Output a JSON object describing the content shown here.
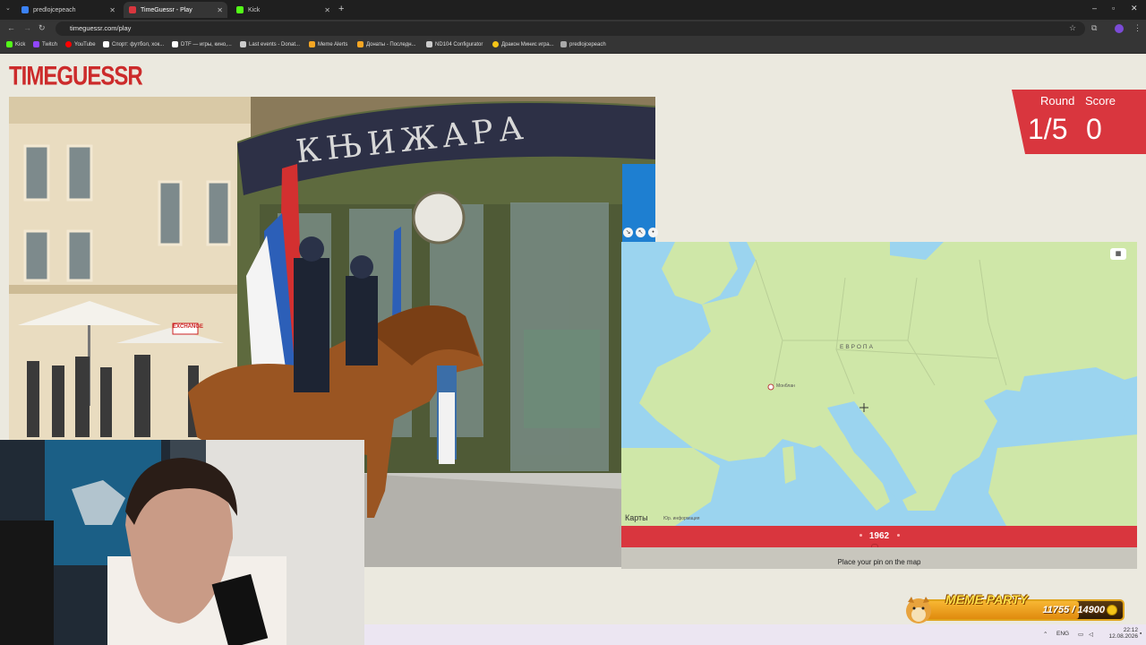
{
  "browser": {
    "tabs": [
      {
        "title": "predlojcepeach",
        "color": "#3b82f6"
      },
      {
        "title": "TimeGuessr - Play",
        "color": "#d9363e"
      },
      {
        "title": "Kick",
        "color": "#53fc18"
      }
    ],
    "url": "timeguessr.com/play",
    "bookmarks": [
      {
        "label": "Kick",
        "color": "#53fc18"
      },
      {
        "label": "Twitch",
        "color": "#9146ff"
      },
      {
        "label": "YouTube",
        "color": "#ff0000"
      },
      {
        "label": "Спорт: футбол, хок...",
        "color": "#ffffff"
      },
      {
        "label": "DTF — игры, кино,...",
        "color": "#ffffff"
      },
      {
        "label": "Last events - Donat...",
        "color": "#cccccc"
      },
      {
        "label": "Meme Alerts",
        "color": "#f5a623"
      },
      {
        "label": "Донаты - Последн...",
        "color": "#f5a623"
      },
      {
        "label": "ND104 Configurator",
        "color": "#cccccc"
      },
      {
        "label": "Дракон Минис игра...",
        "color": "#f5c518"
      },
      {
        "label": "predlojcepeach",
        "color": "#aaaaaa"
      }
    ]
  },
  "page": {
    "logo": "TIMEGUESSR",
    "round_label": "Round",
    "round_value": "1/5",
    "score_label": "Score",
    "score_value": "0",
    "photo_sign": "КЊИЖАРА",
    "photo_exchange": "EXCHANGE"
  },
  "map": {
    "label_europe": "ЕВРОПА",
    "city_label": "Монблан",
    "attribution": "Карты",
    "attribution_note": "Юр. информация"
  },
  "year_slider": {
    "year": "1962",
    "hint": "Place your pin on the map"
  },
  "overlay": {
    "title": "MEME PARTY",
    "count": "11755 / 14900",
    "progress": 0.789
  },
  "taskbar": {
    "lang": "ENG",
    "time": "22:12",
    "date": "12.08.2026"
  },
  "colors": {
    "accent": "#d9363e",
    "page_bg": "#ebe9df",
    "map_land": "#cfe7a8",
    "map_water": "#9bd4ef"
  }
}
